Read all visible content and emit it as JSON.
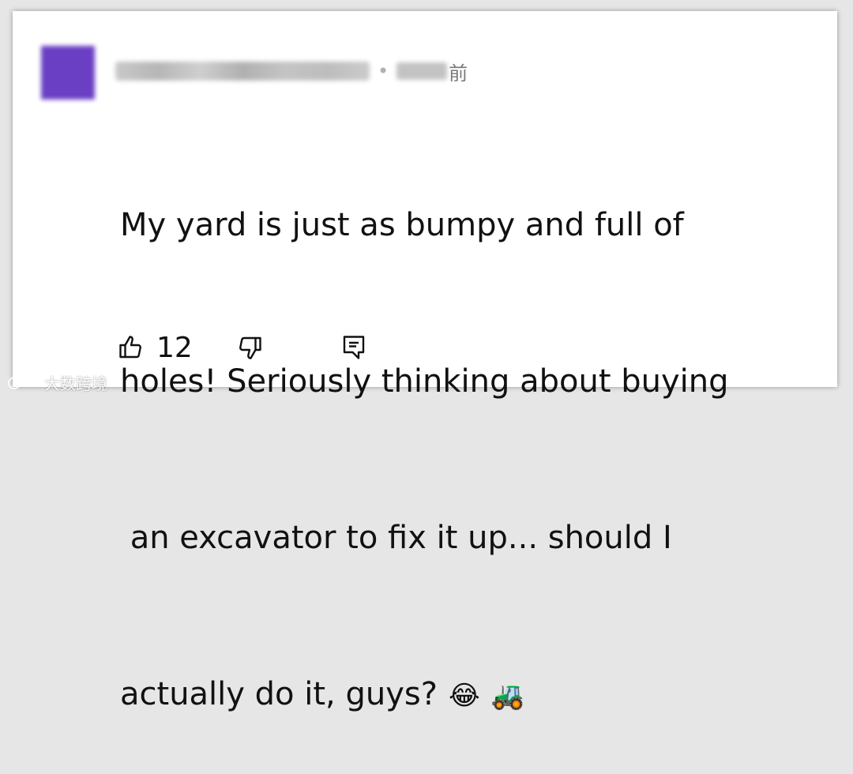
{
  "comment": {
    "meta": {
      "separator": "•",
      "time_suffix": "前"
    },
    "lines": [
      "My yard is just as bumpy and full of",
      "holes! Seriously thinking about buying",
      " an excavator to fix it up... should I",
      "actually do it, guys?"
    ],
    "emojis": [
      "😂",
      "🚜"
    ]
  },
  "actions": {
    "like_count": "12",
    "icons": [
      "thumbs-up-icon",
      "thumbs-down-icon",
      "reply-icon"
    ]
  },
  "watermark": {
    "text": "大数跨境"
  }
}
